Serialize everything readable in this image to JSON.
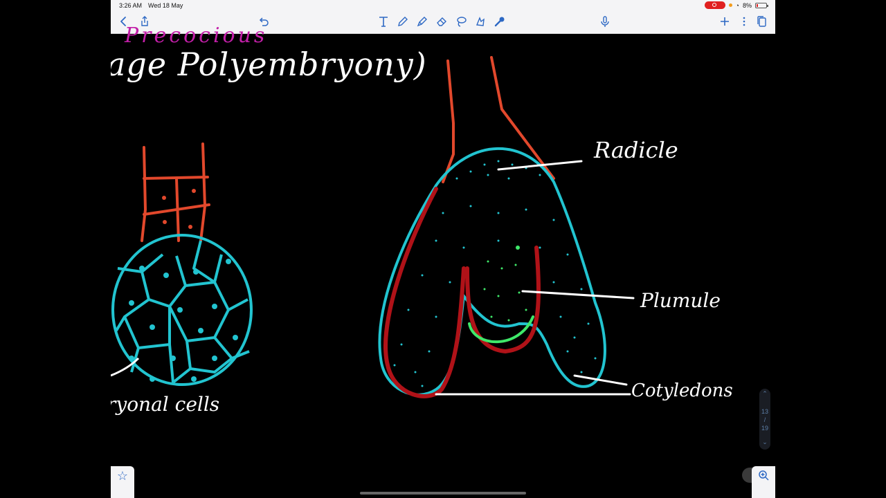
{
  "status_bar": {
    "time": "3:26 AM",
    "date": "Wed 18 May",
    "battery": "8%"
  },
  "toolbar": {
    "icons": [
      "back-icon",
      "share-icon",
      "undo-icon",
      "text-tool-icon",
      "pen-icon",
      "highlighter-icon",
      "eraser-icon",
      "lasso-icon",
      "shapes-icon",
      "laser-pointer-icon",
      "microphone-icon",
      "add-icon",
      "more-icon",
      "pages-icon"
    ],
    "accent_color": "#2d68c4"
  },
  "canvas": {
    "heading": "age Polyembryony)",
    "sub_heading": "Precocious",
    "labels": {
      "radicle": "Radicle",
      "plumule": "Plumule",
      "cotyledons": "Cotyledons",
      "cells": "ryonal cells"
    },
    "colors": {
      "background": "#000000",
      "ink_white": "#ffffff",
      "ink_orange": "#e2482c",
      "ink_cyan": "#22c4d0",
      "ink_red": "#b01218",
      "ink_green": "#3fe86a",
      "ink_magenta": "#c21fa8"
    }
  },
  "pager": {
    "current": "13",
    "separator": "/",
    "total": "19"
  }
}
